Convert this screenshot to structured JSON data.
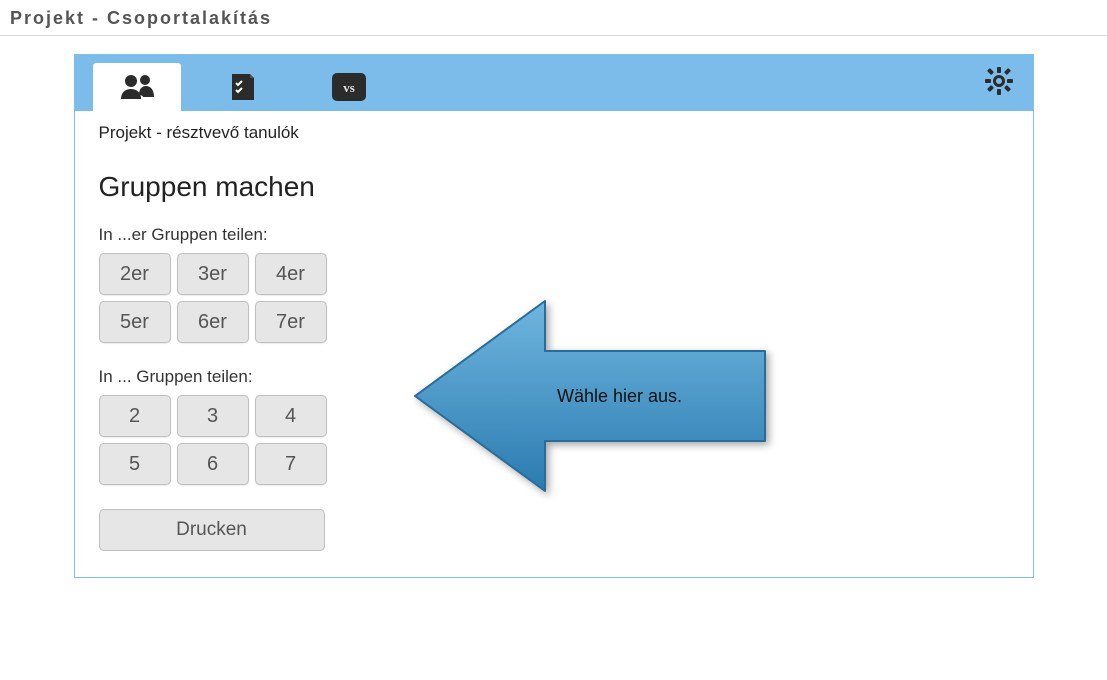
{
  "page_title": "Projekt - Csoportalakítás",
  "subtitle": "Projekt - résztvevő tanulók",
  "heading": "Gruppen machen",
  "section1_label": "In ...er Gruppen teilen:",
  "group_size_buttons": [
    "2er",
    "3er",
    "4er",
    "5er",
    "6er",
    "7er"
  ],
  "section2_label": "In ... Gruppen teilen:",
  "group_count_buttons": [
    "2",
    "3",
    "4",
    "5",
    "6",
    "7"
  ],
  "print_label": "Drucken",
  "callout_text": "Wähle hier aus."
}
